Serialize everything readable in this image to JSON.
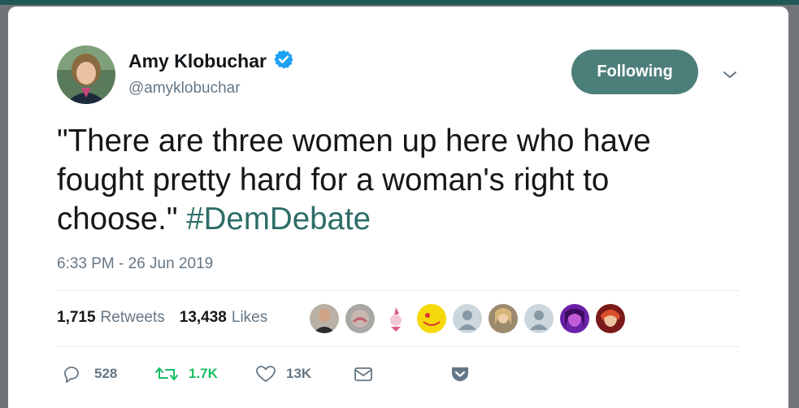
{
  "user": {
    "name": "Amy Klobuchar",
    "handle": "@amyklobuchar",
    "verified": true,
    "follow_button_label": "Following"
  },
  "tweet": {
    "text_line1": "\"There are three women up here who have",
    "text_line2": "fought pretty hard for a woman's right to",
    "text_line3_prefix": "choose.\" ",
    "hashtag": "#DemDebate",
    "timestamp": "6:33 PM - 26 Jun 2019"
  },
  "stats": {
    "retweets_count": "1,715",
    "retweets_label": "Retweets",
    "likes_count": "13,438",
    "likes_label": "Likes"
  },
  "actions": {
    "reply_count": "528",
    "retweet_count": "1.7K",
    "like_count": "13K"
  },
  "colors": {
    "accent": "#4d7f7a",
    "hashtag": "#2d6d68",
    "verified": "#1da1f2",
    "retweet_green": "#17bf63",
    "secondary_text": "#657786"
  },
  "icons": [
    "verified-badge-icon",
    "chevron-down-icon",
    "reply-icon",
    "retweet-icon",
    "like-icon",
    "message-icon",
    "share-pocket-icon"
  ]
}
